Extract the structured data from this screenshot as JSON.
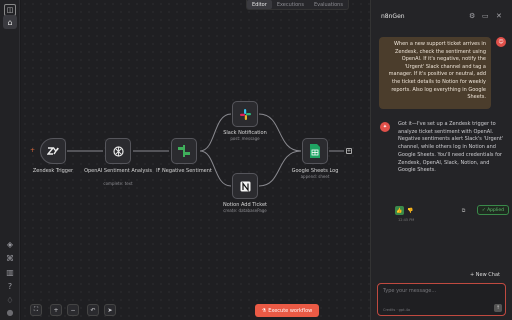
{
  "tabs": [
    {
      "label": "Editor",
      "active": true
    },
    {
      "label": "Executions",
      "active": false
    },
    {
      "label": "Evaluations",
      "active": false
    }
  ],
  "nodes": {
    "zendesk": {
      "label": "Zendesk Trigger",
      "sub": "",
      "icon": "zendesk-icon"
    },
    "openai": {
      "label": "OpenAI Sentiment Analysis",
      "sub": "complete: text",
      "icon": "openai-icon"
    },
    "if": {
      "label": "IF Negative Sentiment",
      "sub": "",
      "icon": "if-branch-icon"
    },
    "slack": {
      "label": "Slack Notification",
      "sub": "post: message",
      "icon": "slack-icon"
    },
    "notion": {
      "label": "Notion Add Ticket",
      "sub": "create: databasePage",
      "icon": "notion-icon"
    },
    "sheets": {
      "label": "Google Sheets Log",
      "sub": "append: sheet",
      "icon": "google-sheets-icon"
    }
  },
  "toolbar": {
    "execute_label": "Execute workflow"
  },
  "panel": {
    "title": "n8nGen",
    "user_message": "When a new support ticket arrives in Zendesk, check the sentiment using OpenAI. If it's negative, notify the 'Urgent' Slack channel and tag a manager. If it's positive or neutral, add the ticket details to Notion for weekly reports. Also log everything in Google Sheets.",
    "bot_message": "Got it—I've set up a Zendesk trigger to analyze ticket sentiment with OpenAI. Negative sentiments alert Slack's 'Urgent' channel, while others log in Notion and Google Sheets. You'll need credentials for Zendesk, OpenAI, Slack, Notion, and Google Sheets.",
    "applied_label": "✓ Applied",
    "message_time": "12:45 PM",
    "new_chat_label": "+ New Chat",
    "input_placeholder": "Type your message...",
    "input_meta": "Credits · gpt-4o"
  },
  "colors": {
    "accent": "#ea5a45",
    "user_bubble": "#4b3d2c",
    "applied": "#5fc06d"
  }
}
